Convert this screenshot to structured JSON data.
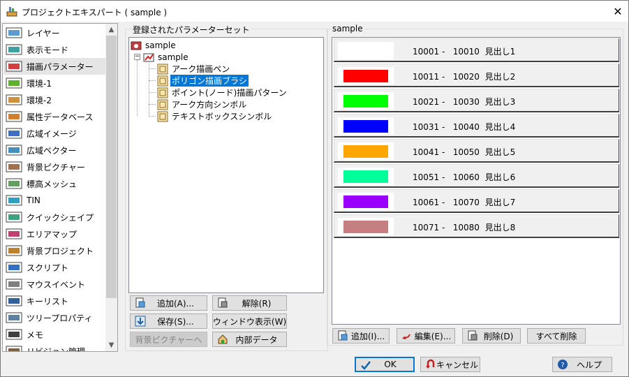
{
  "window": {
    "title": "プロジェクトエキスパート ( sample )",
    "close_glyph": "✕"
  },
  "nav": {
    "items": [
      {
        "label": "レイヤー",
        "icon": "layer-icon"
      },
      {
        "label": "表示モード",
        "icon": "display-mode-icon"
      },
      {
        "label": "描画パラメーター",
        "icon": "draw-parameter-icon"
      },
      {
        "label": "環境-1",
        "icon": "environment-1-icon"
      },
      {
        "label": "環境-2",
        "icon": "environment-2-icon"
      },
      {
        "label": "属性データベース",
        "icon": "attribute-database-icon"
      },
      {
        "label": "広域イメージ",
        "icon": "wide-image-icon"
      },
      {
        "label": "広域ベクター",
        "icon": "wide-vector-icon"
      },
      {
        "label": "背景ピクチャー",
        "icon": "background-picture-icon"
      },
      {
        "label": "標高メッシュ",
        "icon": "elevation-mesh-icon"
      },
      {
        "label": "TIN",
        "icon": "tin-icon"
      },
      {
        "label": "クイックシェイプ",
        "icon": "quick-shape-icon"
      },
      {
        "label": "エリアマップ",
        "icon": "area-map-icon"
      },
      {
        "label": "背景プロジェクト",
        "icon": "background-project-icon"
      },
      {
        "label": "スクリプト",
        "icon": "script-icon"
      },
      {
        "label": "マウスイベント",
        "icon": "mouse-event-icon"
      },
      {
        "label": "キーリスト",
        "icon": "key-list-icon"
      },
      {
        "label": "ツリープロパティ",
        "icon": "tree-property-icon"
      },
      {
        "label": "メモ",
        "icon": "memo-icon"
      },
      {
        "label": "リビジョン管理",
        "icon": "revision-icon"
      }
    ],
    "selected_index": 2
  },
  "param_set": {
    "group_label": "登録されたパラメーターセット",
    "tree": {
      "root": "sample",
      "child": "sample",
      "leaves": [
        "アーク描画ペン",
        "ポリゴン描画ブラシ",
        "ポイント(ノード)描画パターン",
        "アーク方向シンボル",
        "テキストボックスシンボル"
      ],
      "selected_leaf": 1
    },
    "buttons": {
      "add": "追加(A)...",
      "release": "解除(R)",
      "save": "保存(S)...",
      "window_show": "ウィンドウ表示(W)",
      "bg_picture": "背景ピクチャーへ",
      "internal_data": "内部データ"
    }
  },
  "legend": {
    "group_label": "sample",
    "rows": [
      {
        "color": "#ffffff",
        "from": "10001",
        "to": "10010",
        "caption": "見出し1"
      },
      {
        "color": "#ff0000",
        "from": "10011",
        "to": "10020",
        "caption": "見出し2"
      },
      {
        "color": "#00ff00",
        "from": "10021",
        "to": "10030",
        "caption": "見出し3"
      },
      {
        "color": "#0000ff",
        "from": "10031",
        "to": "10040",
        "caption": "見出し4"
      },
      {
        "color": "#ffa500",
        "from": "10041",
        "to": "10050",
        "caption": "見出し5"
      },
      {
        "color": "#00ff99",
        "from": "10051",
        "to": "10060",
        "caption": "見出し6"
      },
      {
        "color": "#9900ff",
        "from": "10061",
        "to": "10070",
        "caption": "見出し7"
      },
      {
        "color": "#c48080",
        "from": "10071",
        "to": "10080",
        "caption": "見出し8"
      }
    ],
    "buttons": {
      "add": "追加(I)...",
      "edit": "編集(E)...",
      "delete": "削除(D)",
      "delete_all": "すべて削除"
    }
  },
  "footer": {
    "ok": "OK",
    "cancel": "キャンセル",
    "help": "ヘルプ"
  }
}
